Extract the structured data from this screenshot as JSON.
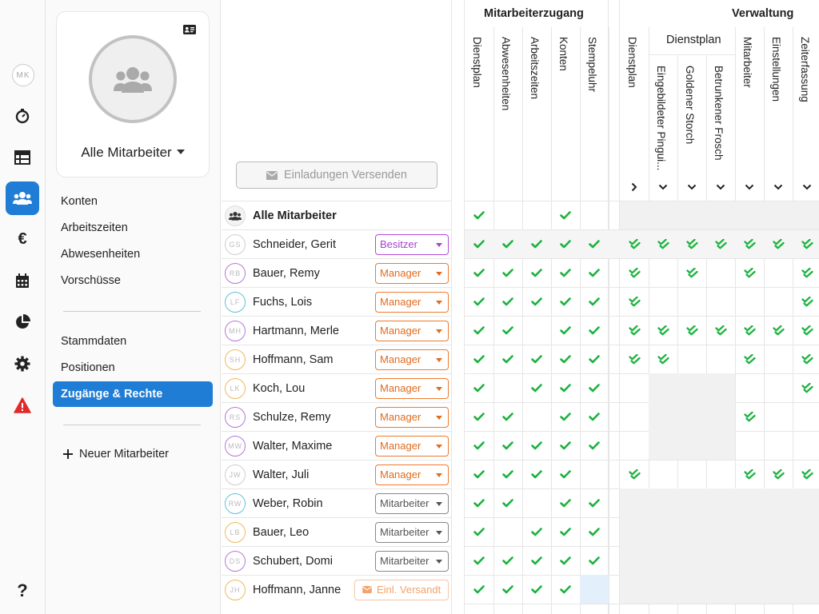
{
  "rail": {
    "avatar_initials": "MK",
    "items": [
      "stopwatch-icon",
      "table-icon",
      "users-icon",
      "euro-icon",
      "calendar-icon",
      "pie-chart-icon",
      "gear-icon",
      "warning-icon"
    ],
    "active": "users-icon",
    "help": "?"
  },
  "sidebar": {
    "card_title": "Alle Mitarbeiter",
    "links_top": [
      "Konten",
      "Arbeitszeiten",
      "Abwesenheiten",
      "Vorschüsse"
    ],
    "links_mid": [
      "Stammdaten",
      "Positionen"
    ],
    "active_link": "Zugänge & Rechte",
    "new_employee": "Neuer Mitarbeiter"
  },
  "list": {
    "invite_button": "Einladungen Versenden",
    "all_label": "Alle Mitarbeiter",
    "employees": [
      {
        "initials": "GS",
        "name": "Schneider, Gerit",
        "role": "Besitzer",
        "role_type": "besitzer",
        "avatar_color": "#cfcfcf"
      },
      {
        "initials": "RB",
        "name": "Bauer, Remy",
        "role": "Manager",
        "role_type": "manager",
        "avatar_color": "#b679d8"
      },
      {
        "initials": "LF",
        "name": "Fuchs, Lois",
        "role": "Manager",
        "role_type": "manager",
        "avatar_color": "#5cc3d8"
      },
      {
        "initials": "MH",
        "name": "Hartmann, Merle",
        "role": "Manager",
        "role_type": "manager",
        "avatar_color": "#b679d8"
      },
      {
        "initials": "SH",
        "name": "Hoffmann, Sam",
        "role": "Manager",
        "role_type": "manager",
        "avatar_color": "#f0b95b"
      },
      {
        "initials": "LK",
        "name": "Koch, Lou",
        "role": "Manager",
        "role_type": "manager",
        "avatar_color": "#f0b95b"
      },
      {
        "initials": "RS",
        "name": "Schulze, Remy",
        "role": "Manager",
        "role_type": "manager",
        "avatar_color": "#b679d8"
      },
      {
        "initials": "MW",
        "name": "Walter, Maxime",
        "role": "Manager",
        "role_type": "manager",
        "avatar_color": "#b679d8"
      },
      {
        "initials": "JW",
        "name": "Walter, Juli",
        "role": "Manager",
        "role_type": "manager",
        "avatar_color": "#cfcfcf"
      },
      {
        "initials": "RW",
        "name": "Weber, Robin",
        "role": "Mitarbeiter",
        "role_type": "mitarbeiter",
        "avatar_color": "#5cc3d8"
      },
      {
        "initials": "LB",
        "name": "Bauer, Leo",
        "role": "Mitarbeiter",
        "role_type": "mitarbeiter",
        "avatar_color": "#f0b95b"
      },
      {
        "initials": "DS",
        "name": "Schubert, Domi",
        "role": "Mitarbeiter",
        "role_type": "mitarbeiter",
        "avatar_color": "#b679d8"
      },
      {
        "initials": "JH",
        "name": "Hoffmann, Janne",
        "role": "Einl. Versandt",
        "role_type": "versandt",
        "avatar_color": "#f0b95b"
      }
    ]
  },
  "permissions": {
    "group_access": "Mitarbeiterzugang",
    "group_admin": "Verwaltung",
    "subgroup_dienstplan": "Dienstplan",
    "access_columns": [
      "Dienstplan",
      "Abwesenheiten",
      "Arbeitszeiten",
      "Konten",
      "Stempeluhr"
    ],
    "admin_columns": [
      "Dienstplan",
      "Eingebildeter Pingui...",
      "Goldener Storch",
      "Betrunkener Frosch",
      "Mitarbeiter",
      "Einstellungen",
      "Zeiterfassung"
    ],
    "access_all": [
      1,
      0,
      0,
      1,
      0
    ],
    "access_rows": [
      [
        1,
        1,
        1,
        1,
        1
      ],
      [
        1,
        1,
        1,
        1,
        1
      ],
      [
        1,
        1,
        1,
        1,
        1
      ],
      [
        1,
        1,
        0,
        1,
        1
      ],
      [
        1,
        1,
        1,
        1,
        1
      ],
      [
        1,
        0,
        1,
        1,
        1
      ],
      [
        1,
        1,
        0,
        1,
        1
      ],
      [
        1,
        1,
        1,
        1,
        1
      ],
      [
        1,
        1,
        1,
        1,
        0
      ],
      [
        1,
        1,
        0,
        1,
        1
      ],
      [
        1,
        0,
        1,
        1,
        1
      ],
      [
        1,
        1,
        1,
        1,
        1
      ],
      [
        1,
        1,
        1,
        1,
        "b"
      ]
    ],
    "admin_rows": [
      [
        1,
        1,
        1,
        1,
        1,
        1,
        1
      ],
      [
        1,
        0,
        1,
        0,
        1,
        0,
        1
      ],
      [
        1,
        0,
        0,
        0,
        0,
        0,
        1
      ],
      [
        1,
        1,
        1,
        1,
        1,
        1,
        1
      ],
      [
        1,
        1,
        0,
        0,
        1,
        0,
        1
      ],
      [
        "0",
        "g",
        "g",
        "g",
        0,
        0,
        1
      ],
      [
        "0",
        "g",
        "g",
        "g",
        1,
        0,
        0
      ],
      [
        "0",
        "g",
        "g",
        "g",
        0,
        0,
        0
      ],
      [
        1,
        0,
        0,
        0,
        1,
        1,
        1
      ],
      [
        "g",
        "g",
        "g",
        "g",
        "g",
        "g",
        "g"
      ],
      [
        "g",
        "g",
        "g",
        "g",
        "g",
        "g",
        "g"
      ],
      [
        "g",
        "g",
        "g",
        "g",
        "g",
        "g",
        "g"
      ],
      [
        "g",
        "g",
        "g",
        "g",
        "g",
        "g",
        "g"
      ]
    ]
  },
  "colors": {
    "accent": "#1f7dd5",
    "check": "#1bb33e",
    "owner": "#b44ad9",
    "manager": "#ef7a2c"
  }
}
